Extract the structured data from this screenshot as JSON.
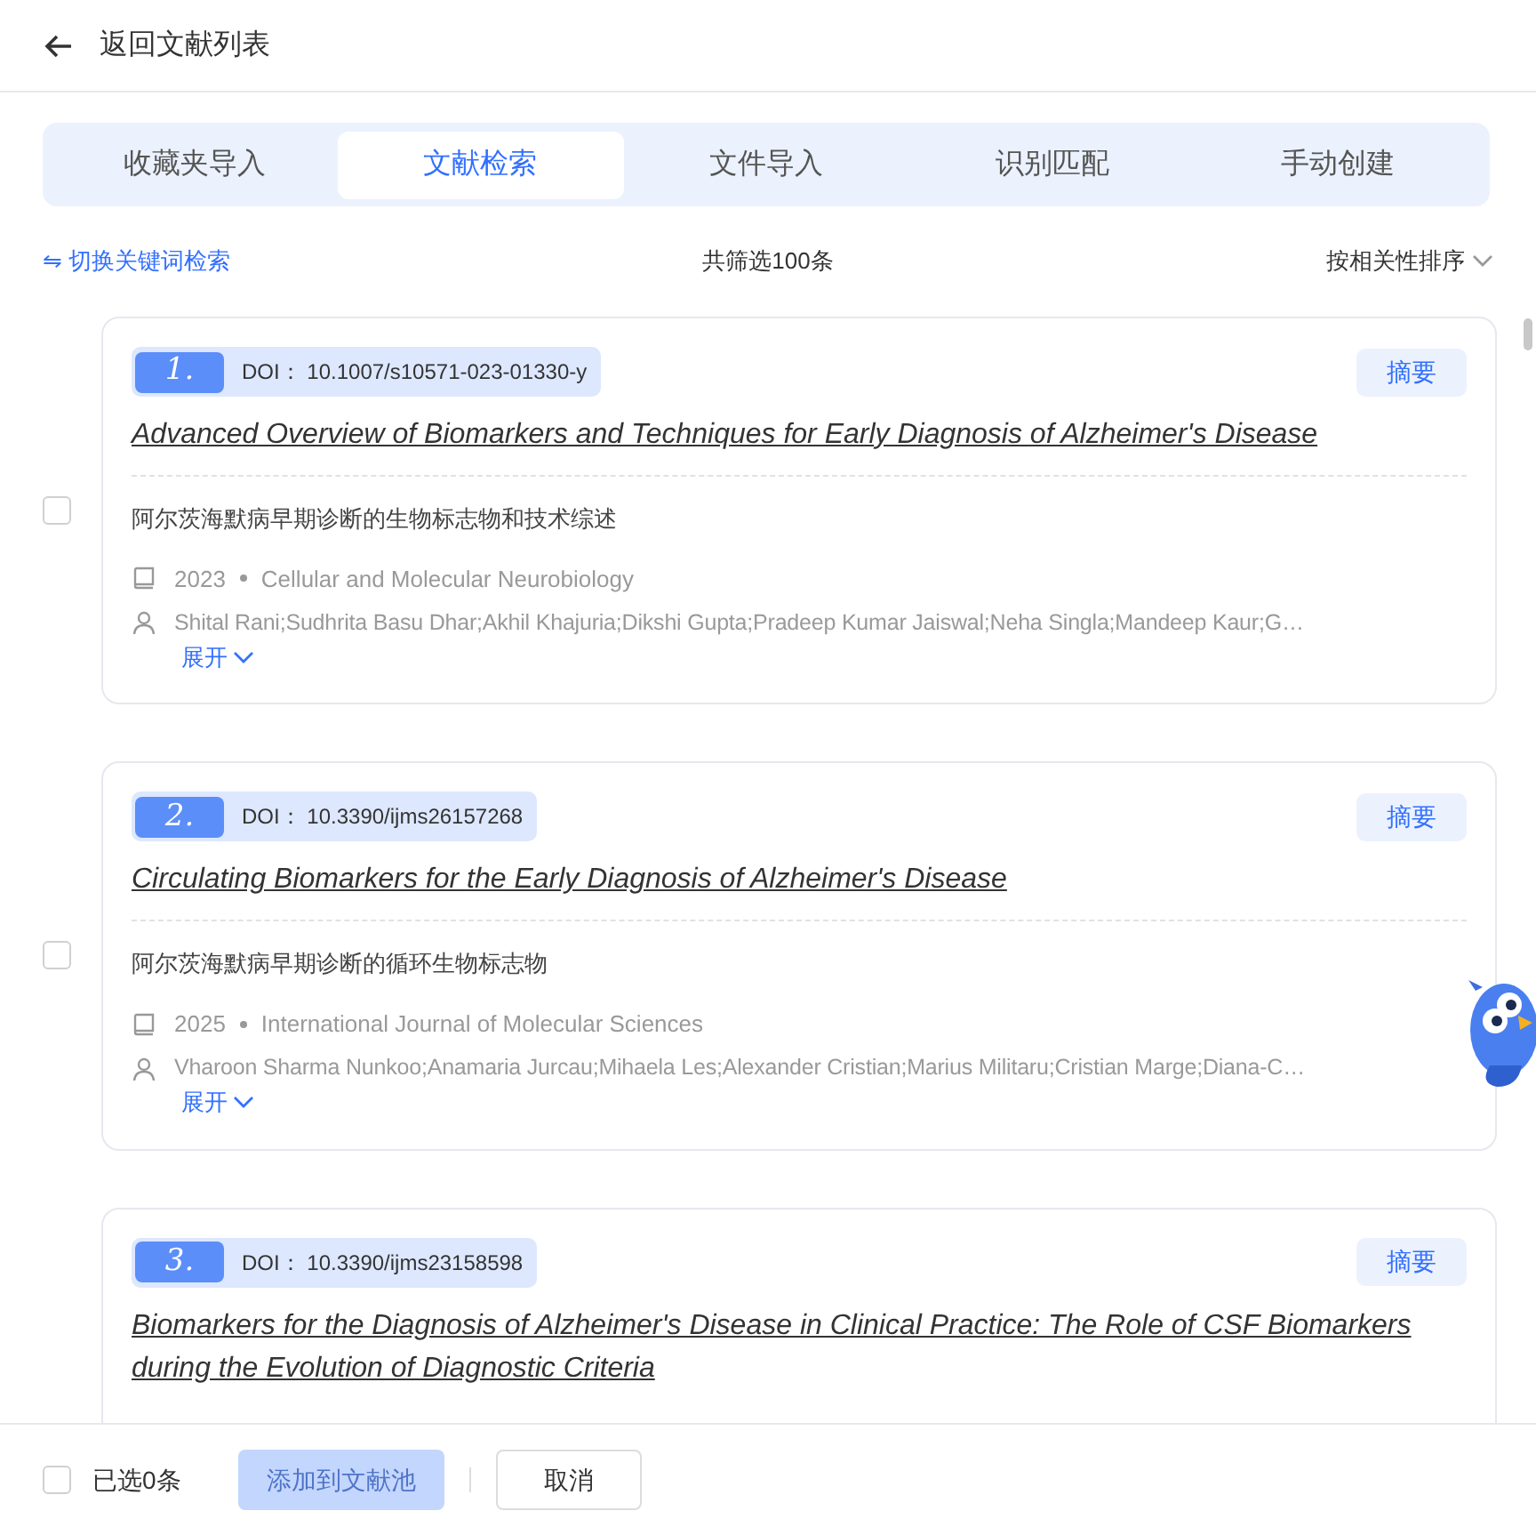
{
  "header": {
    "back_label": "返回文献列表"
  },
  "tabs": [
    {
      "label": "收藏夹导入",
      "selected": false
    },
    {
      "label": "文献检索",
      "selected": true
    },
    {
      "label": "文件导入",
      "selected": false
    },
    {
      "label": "识别匹配",
      "selected": false
    },
    {
      "label": "手动创建",
      "selected": false
    }
  ],
  "toolbar": {
    "switch_link": "⇋ 切换关键词检索",
    "count": "共筛选100条",
    "sort": "按相关性排序"
  },
  "results": [
    {
      "checked": false,
      "index": "1.",
      "doi_label": "DOI：",
      "doi": "10.1007/s10571-023-01330-y",
      "abstract_button": "摘要",
      "title": "Advanced Overview of Biomarkers and Techniques for Early Diagnosis of Alzheimer's Disease",
      "title_zh": "阿尔茨海默病早期诊断的生物标志物和技术综述",
      "year": "2023",
      "journal": "Cellular and Molecular Neurobiology",
      "authors": "Shital Rani;Sudhrita Basu Dhar;Akhil Khajuria;Dikshi Gupta;Pradeep Kumar Jaiswal;Neha Singla;Mandeep Kaur;G…",
      "expand": "展开"
    },
    {
      "checked": false,
      "index": "2.",
      "doi_label": "DOI：",
      "doi": "10.3390/ijms26157268",
      "abstract_button": "摘要",
      "title": "Circulating Biomarkers for the Early Diagnosis of Alzheimer's Disease",
      "title_zh": "阿尔茨海默病早期诊断的循环生物标志物",
      "year": "2025",
      "journal": "International Journal of Molecular Sciences",
      "authors": "Vharoon Sharma Nunkoo;Anamaria Jurcau;Mihaela Les;Alexander Cristian;Marius Militaru;Cristian Marge;Diana-C…",
      "expand": "展开"
    },
    {
      "index": "3.",
      "doi_label": "DOI：",
      "doi": "10.3390/ijms23158598",
      "abstract_button": "摘要",
      "title": "Biomarkers for the Diagnosis of Alzheimer's Disease in Clinical Practice: The Role of CSF Biomarkers during the Evolution of Diagnostic Criteria"
    }
  ],
  "footer": {
    "select_all_checked": false,
    "selected_count": "已选0条",
    "add_button": "添加到文献池",
    "add_disabled": true,
    "cancel_button": "取消"
  }
}
